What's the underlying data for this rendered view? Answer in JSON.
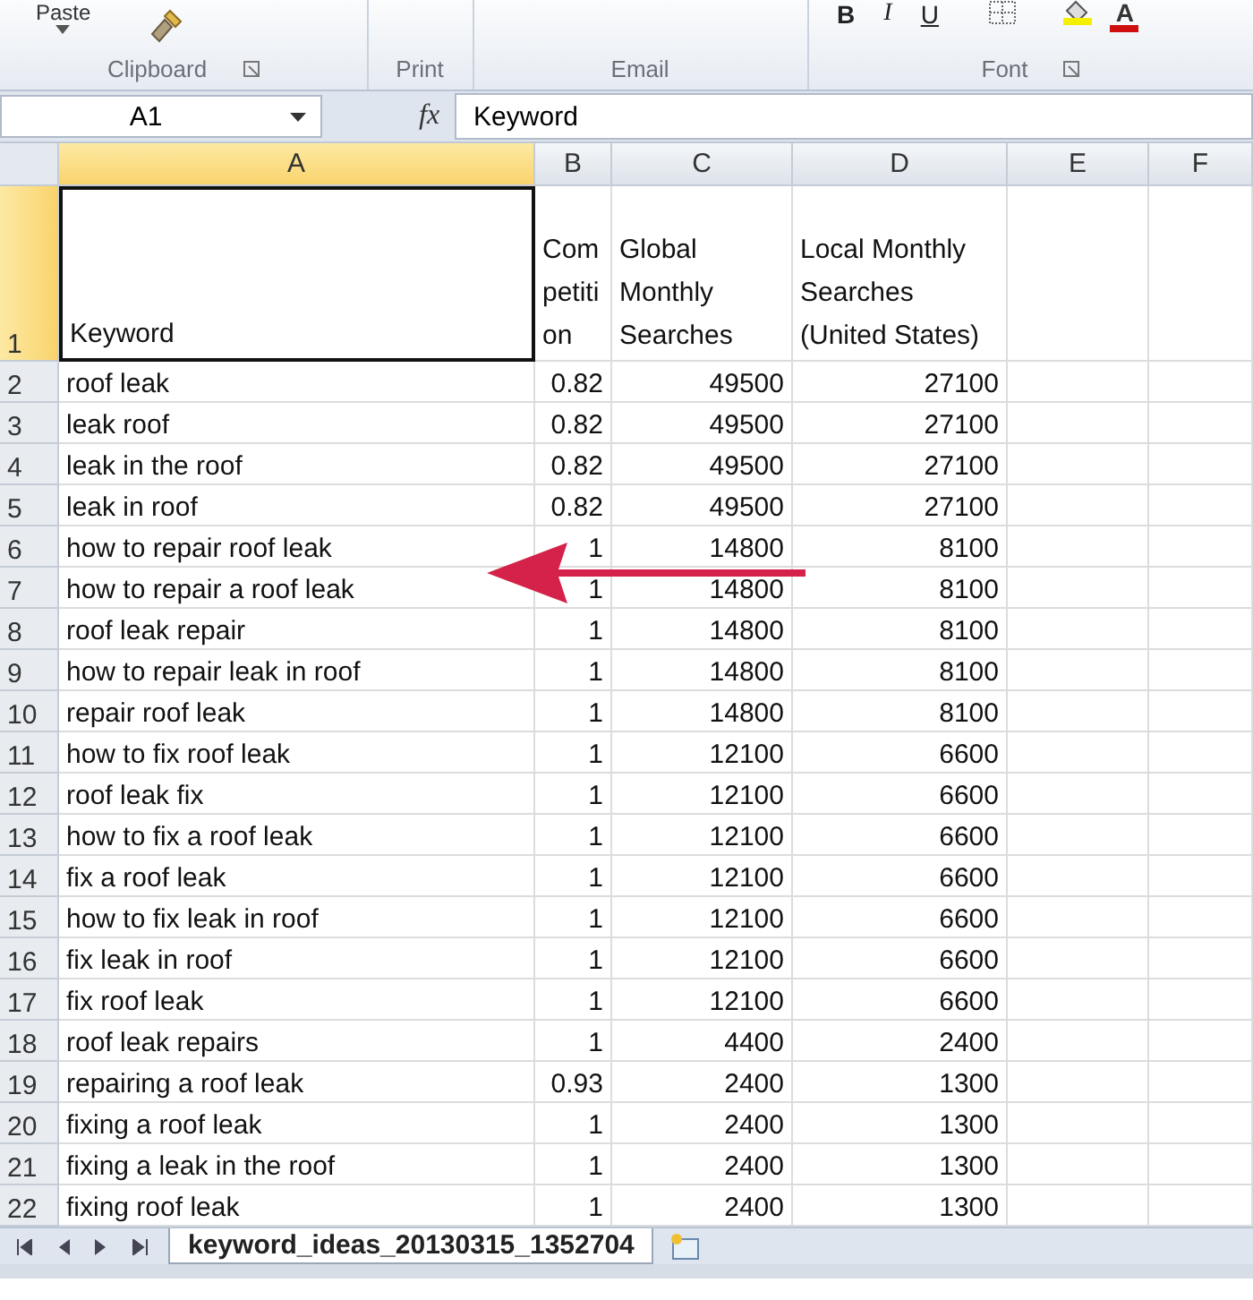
{
  "ribbon": {
    "groups": [
      {
        "label": "Clipboard",
        "kind": "clipboard",
        "paste": "Paste"
      },
      {
        "label": "Print",
        "kind": "empty"
      },
      {
        "label": "Email",
        "kind": "empty"
      },
      {
        "label": "Font",
        "kind": "font",
        "bold": "B",
        "italic": "I",
        "underline": "U",
        "font_color": "A"
      }
    ]
  },
  "formula_bar": {
    "name_box": "A1",
    "fx": "fx",
    "formula": "Keyword"
  },
  "columns": [
    {
      "label": "A",
      "selected": true,
      "kind": "text"
    },
    {
      "label": "B",
      "selected": false,
      "kind": "number"
    },
    {
      "label": "C",
      "selected": false,
      "kind": "number"
    },
    {
      "label": "D",
      "selected": false,
      "kind": "number"
    },
    {
      "label": "E",
      "selected": false,
      "kind": "text"
    },
    {
      "label": "F",
      "selected": false,
      "kind": "text"
    }
  ],
  "rows": [
    {
      "number": "1",
      "selected": true,
      "cells": [
        "Keyword",
        "Competition",
        "Global Monthly Searches",
        "Local Monthly Searches (United States)"
      ]
    },
    {
      "number": "2",
      "selected": false,
      "cells": [
        "roof leak",
        "0.82",
        "49500",
        "27100"
      ]
    },
    {
      "number": "3",
      "selected": false,
      "cells": [
        "leak roof",
        "0.82",
        "49500",
        "27100"
      ]
    },
    {
      "number": "4",
      "selected": false,
      "cells": [
        "leak in the roof",
        "0.82",
        "49500",
        "27100"
      ]
    },
    {
      "number": "5",
      "selected": false,
      "cells": [
        "leak in roof",
        "0.82",
        "49500",
        "27100"
      ]
    },
    {
      "number": "6",
      "selected": false,
      "cells": [
        "how to repair roof leak",
        "1",
        "14800",
        "8100"
      ]
    },
    {
      "number": "7",
      "selected": false,
      "cells": [
        "how to repair a roof leak",
        "1",
        "14800",
        "8100"
      ]
    },
    {
      "number": "8",
      "selected": false,
      "cells": [
        "roof leak repair",
        "1",
        "14800",
        "8100"
      ]
    },
    {
      "number": "9",
      "selected": false,
      "cells": [
        "how to repair leak in roof",
        "1",
        "14800",
        "8100"
      ]
    },
    {
      "number": "10",
      "selected": false,
      "cells": [
        "repair roof leak",
        "1",
        "14800",
        "8100"
      ]
    },
    {
      "number": "11",
      "selected": false,
      "cells": [
        "how to fix roof leak",
        "1",
        "12100",
        "6600"
      ]
    },
    {
      "number": "12",
      "selected": false,
      "cells": [
        "roof leak fix",
        "1",
        "12100",
        "6600"
      ]
    },
    {
      "number": "13",
      "selected": false,
      "cells": [
        "how to fix a roof leak",
        "1",
        "12100",
        "6600"
      ]
    },
    {
      "number": "14",
      "selected": false,
      "cells": [
        "fix a roof leak",
        "1",
        "12100",
        "6600"
      ]
    },
    {
      "number": "15",
      "selected": false,
      "cells": [
        "how to fix leak in roof",
        "1",
        "12100",
        "6600"
      ]
    },
    {
      "number": "16",
      "selected": false,
      "cells": [
        "fix leak in roof",
        "1",
        "12100",
        "6600"
      ]
    },
    {
      "number": "17",
      "selected": false,
      "cells": [
        "fix roof leak",
        "1",
        "12100",
        "6600"
      ]
    },
    {
      "number": "18",
      "selected": false,
      "cells": [
        "roof leak repairs",
        "1",
        "4400",
        "2400"
      ]
    },
    {
      "number": "19",
      "selected": false,
      "cells": [
        "repairing a roof leak",
        "0.93",
        "2400",
        "1300"
      ]
    },
    {
      "number": "20",
      "selected": false,
      "cells": [
        "fixing a roof leak",
        "1",
        "2400",
        "1300"
      ]
    },
    {
      "number": "21",
      "selected": false,
      "cells": [
        "fixing a leak in the roof",
        "1",
        "2400",
        "1300"
      ]
    },
    {
      "number": "22",
      "selected": false,
      "cells": [
        "fixing roof leak",
        "1",
        "2400",
        "1300"
      ]
    }
  ],
  "sheet_tabs": [
    {
      "label": "keyword_ideas_20130315_1352704",
      "selected": true
    }
  ]
}
